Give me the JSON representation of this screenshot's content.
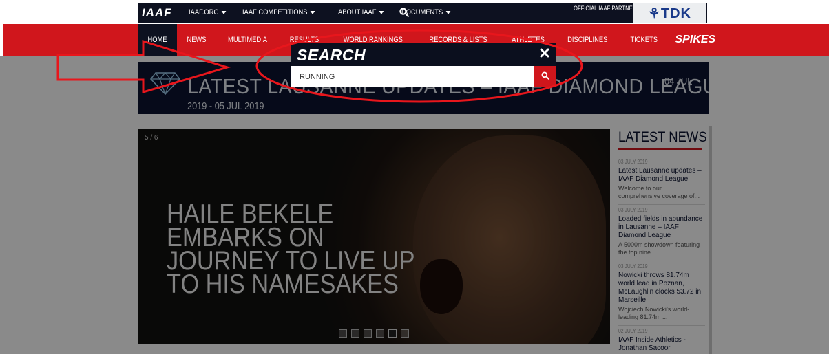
{
  "topbar": {
    "logo": "IAAF",
    "nav": [
      {
        "label": "IAAF.ORG",
        "dropdown": true
      },
      {
        "label": "IAAF COMPETITIONS",
        "dropdown": true
      },
      {
        "label": "ABOUT IAAF",
        "dropdown": true
      },
      {
        "label": "DOCUMENTS",
        "dropdown": true
      }
    ],
    "search_icon": "search-icon",
    "partner_label": "OFFICIAL IAAF PARTNER",
    "partner_name": "⚘TDK"
  },
  "mainnav": {
    "items": [
      "HOME",
      "NEWS",
      "MULTIMEDIA",
      "RESULTS",
      "WORLD RANKINGS",
      "RECORDS & LISTS",
      "ATHLETES",
      "DISCIPLINES",
      "TICKETS"
    ],
    "active": "HOME",
    "spikes": "SPIKES"
  },
  "banner": {
    "title": "LATEST LAUSANNE UPDATES – IAAF DIAMOND LEAGUE",
    "date_start": "04 JUL",
    "date_end": "2019 - 05 JUL 2019",
    "icon": "diamond-icon"
  },
  "hero": {
    "counter": "5 / 6",
    "headline": "HAILE BEKELE EMBARKS ON JOURNEY TO LIVE UP TO HIS NAMESAKES",
    "slide_count": 6,
    "active_slide": 5
  },
  "latest_news": {
    "heading": "LATEST NEWS",
    "items": [
      {
        "date": "03 JULY 2019",
        "title": "Latest Lausanne updates – IAAF Diamond League",
        "snippet": "Welcome to our comprehensive coverage of..."
      },
      {
        "date": "03 JULY 2019",
        "title": "Loaded fields in abundance in Lausanne – IAAF Diamond League",
        "snippet": "A 5000m showdown featuring the top nine ..."
      },
      {
        "date": "03 JULY 2019",
        "title": "Nowicki throws 81.74m world lead in Poznan, McLaughlin clocks 53.72 in Marseille",
        "snippet": "Wojciech Nowicki’s world-leading 81.74m ..."
      },
      {
        "date": "02 JULY 2019",
        "title": "IAAF Inside Athletics - Jonathan Sacoor",
        "snippet": ""
      }
    ]
  },
  "search_modal": {
    "title": "SEARCH",
    "input_value": "RUNNING",
    "close_icon": "close-icon",
    "submit_icon": "search-icon"
  },
  "colors": {
    "nav_red": "#d0161c",
    "navy": "#0d1120",
    "annotation_red": "#e8161c"
  }
}
